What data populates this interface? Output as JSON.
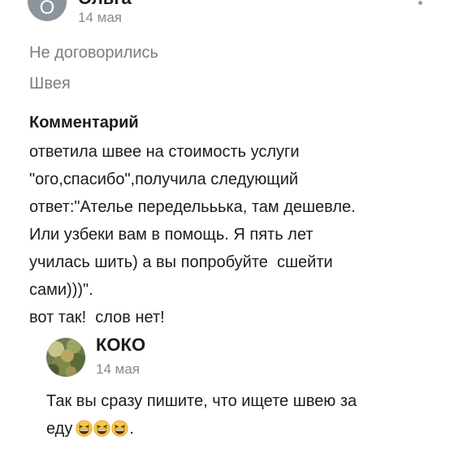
{
  "post": {
    "author_initial": "О",
    "author_name": "Ольга",
    "date": "14 мая",
    "status": "Не договорились",
    "category": "Швея"
  },
  "comment": {
    "heading": "Комментарий",
    "lines": [
      "ответила швее на стоимость услуги",
      "\"ого,спасибо\",получила следующий",
      "ответ:\"Ателье переделььька, там дешевле.",
      "Или узбеки вам в помощь. Я пять лет",
      "училась шить) а вы попробуйте  сшейти",
      "сами)))\".",
      "вот так!  слов нет!"
    ]
  },
  "reply": {
    "author_name": "КОКО",
    "date": "14 мая",
    "line1": "Так вы сразу пишите, что ищете швею за",
    "line2": "еду",
    "line2_end": "."
  },
  "icons": {
    "menu": "kebab-menu-icon",
    "emoji": "grinning-squinting-face-icon"
  },
  "colors": {
    "text": "#1c1c1c",
    "muted": "#7d7d7d",
    "avatar": "#8c949c",
    "emoji_face": "#f7c948"
  }
}
